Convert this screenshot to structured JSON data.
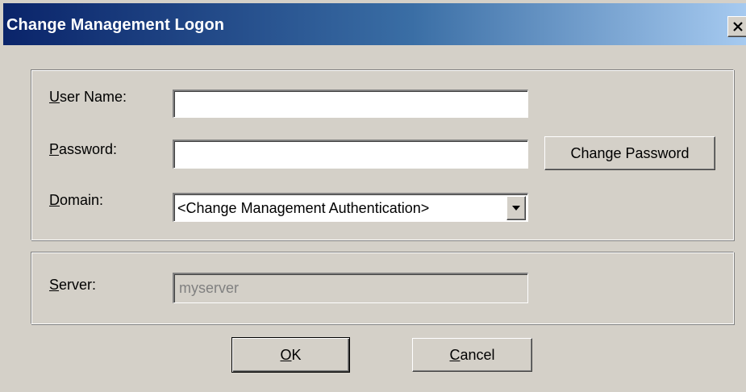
{
  "window": {
    "title": "Change Management Logon"
  },
  "logon": {
    "user_name_label_mnemonic": "U",
    "user_name_label_rest": "ser Name:",
    "user_name_value": "",
    "password_label_mnemonic": "P",
    "password_label_rest": "assword:",
    "password_value": "",
    "change_password_label": "Change Password",
    "domain_label_mnemonic": "D",
    "domain_label_rest": "omain:",
    "domain_selected": "<Change Management Authentication>"
  },
  "server": {
    "label_mnemonic": "S",
    "label_rest": "erver:",
    "value": "myserver"
  },
  "actions": {
    "ok_mnemonic": "O",
    "ok_rest": "K",
    "cancel_mnemonic": "C",
    "cancel_rest": "ancel"
  },
  "icons": {
    "close": "close-icon",
    "dropdown": "chevron-down-icon"
  },
  "colors": {
    "title_gradient_start": "#0a246a",
    "title_gradient_end": "#a6caf0",
    "face": "#d4d0c8"
  }
}
